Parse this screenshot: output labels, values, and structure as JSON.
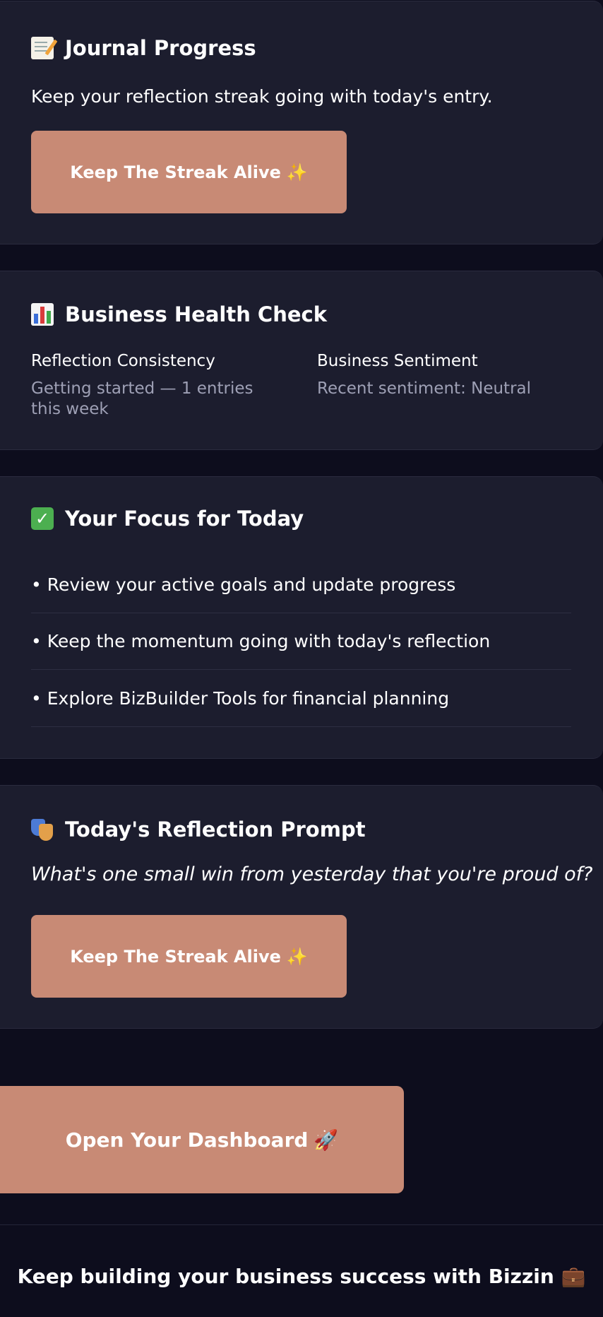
{
  "journal": {
    "title": "Journal Progress",
    "icon": "memo-icon",
    "message": "Keep your reflection streak going with today's entry.",
    "button_label": "Keep The Streak Alive",
    "button_emoji": "✨"
  },
  "health": {
    "title": "Business Health Check",
    "icon": "bar-chart-icon",
    "consistency_label": "Reflection Consistency",
    "consistency_value": "Getting started — 1 entries this week",
    "sentiment_label": "Business Sentiment",
    "sentiment_value": "Recent sentiment: Neutral"
  },
  "focus": {
    "title": "Your Focus for Today",
    "icon": "check-mark-icon",
    "bullet": "•",
    "items": [
      "Review your active goals and update progress",
      "Keep the momentum going with today's reflection",
      "Explore BizBuilder Tools for financial planning"
    ]
  },
  "reflection": {
    "title": "Today's Reflection Prompt",
    "icon": "theater-masks-icon",
    "prompt": "What's one small win from yesterday that you're proud of?",
    "button_label": "Keep The Streak Alive",
    "button_emoji": "✨"
  },
  "dashboard_button": {
    "label": "Open Your Dashboard",
    "emoji": "🚀"
  },
  "footer": {
    "text": "Keep building your business success with Bizzin",
    "emoji": "💼"
  },
  "colors": {
    "background": "#0d0d1d",
    "card": "#1c1d2e",
    "accent": "#c88a75",
    "muted_text": "#9ea0b5"
  }
}
